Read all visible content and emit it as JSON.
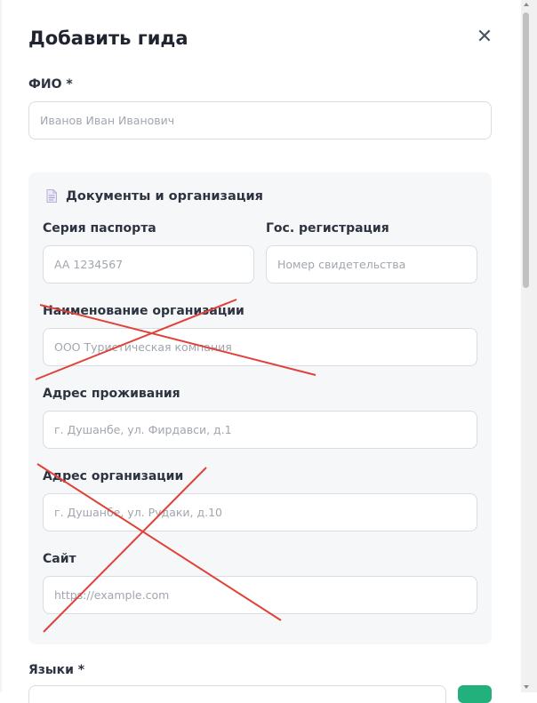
{
  "dialog": {
    "title": "Добавить гида",
    "close_icon": "close-icon"
  },
  "fio": {
    "label": "ФИО *",
    "placeholder": "Иванов Иван Иванович",
    "value": ""
  },
  "documents_section": {
    "title": "Документы и организация",
    "icon": "document-icon",
    "passport": {
      "label": "Серия паспорта",
      "placeholder": "AA 1234567",
      "value": ""
    },
    "registration": {
      "label": "Гос. регистрация",
      "placeholder": "Номер свидетельства",
      "value": ""
    },
    "organization_name": {
      "label": "Наименование организации",
      "placeholder": "ООО Туристическая компания",
      "value": "",
      "crossed_out": true
    },
    "home_address": {
      "label": "Адрес проживания",
      "placeholder": "г. Душанбе, ул. Фирдавси, д.1",
      "value": ""
    },
    "organization_address": {
      "label": "Адрес организации",
      "placeholder": "г. Душанбе, ул. Рудаки, д.10",
      "value": "",
      "crossed_out": true
    },
    "website": {
      "label": "Сайт",
      "placeholder": "https://example.com",
      "value": "",
      "crossed_out": true
    }
  },
  "languages": {
    "label": "Языки *"
  },
  "colors": {
    "accent_green": "#22b07d",
    "strike_red": "#e0423a",
    "section_bg": "#f6f7f9"
  }
}
